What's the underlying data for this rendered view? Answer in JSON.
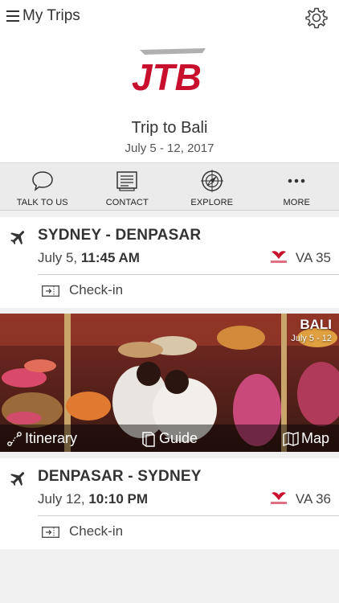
{
  "header": {
    "back_label": "My Trips",
    "trip_title": "Trip to Bali",
    "trip_dates": "July 5 - 12, 2017",
    "brand_color": "#c8102e"
  },
  "toolbar": [
    {
      "label": "TALK TO US",
      "icon": "chat-bubble-icon"
    },
    {
      "label": "CONTACT",
      "icon": "contact-card-icon"
    },
    {
      "label": "EXPLORE",
      "icon": "compass-icon"
    },
    {
      "label": "MORE",
      "icon": "more-dots-icon"
    }
  ],
  "flights": [
    {
      "route": "SYDNEY - DENPASAR",
      "date": "July 5, ",
      "time": "11:45 AM",
      "flight_no": "VA 35",
      "checkin_label": "Check-in"
    },
    {
      "route": "DENPASAR - SYDNEY",
      "date": "July 12, ",
      "time": "10:10 PM",
      "flight_no": "VA 36",
      "checkin_label": "Check-in"
    }
  ],
  "destination": {
    "name": "BALI",
    "dates": "July 5 - 12",
    "links": [
      {
        "label": "Itinerary",
        "icon": "itinerary-route-icon"
      },
      {
        "label": "Guide",
        "icon": "guide-book-icon"
      },
      {
        "label": "Map",
        "icon": "map-icon"
      }
    ]
  }
}
